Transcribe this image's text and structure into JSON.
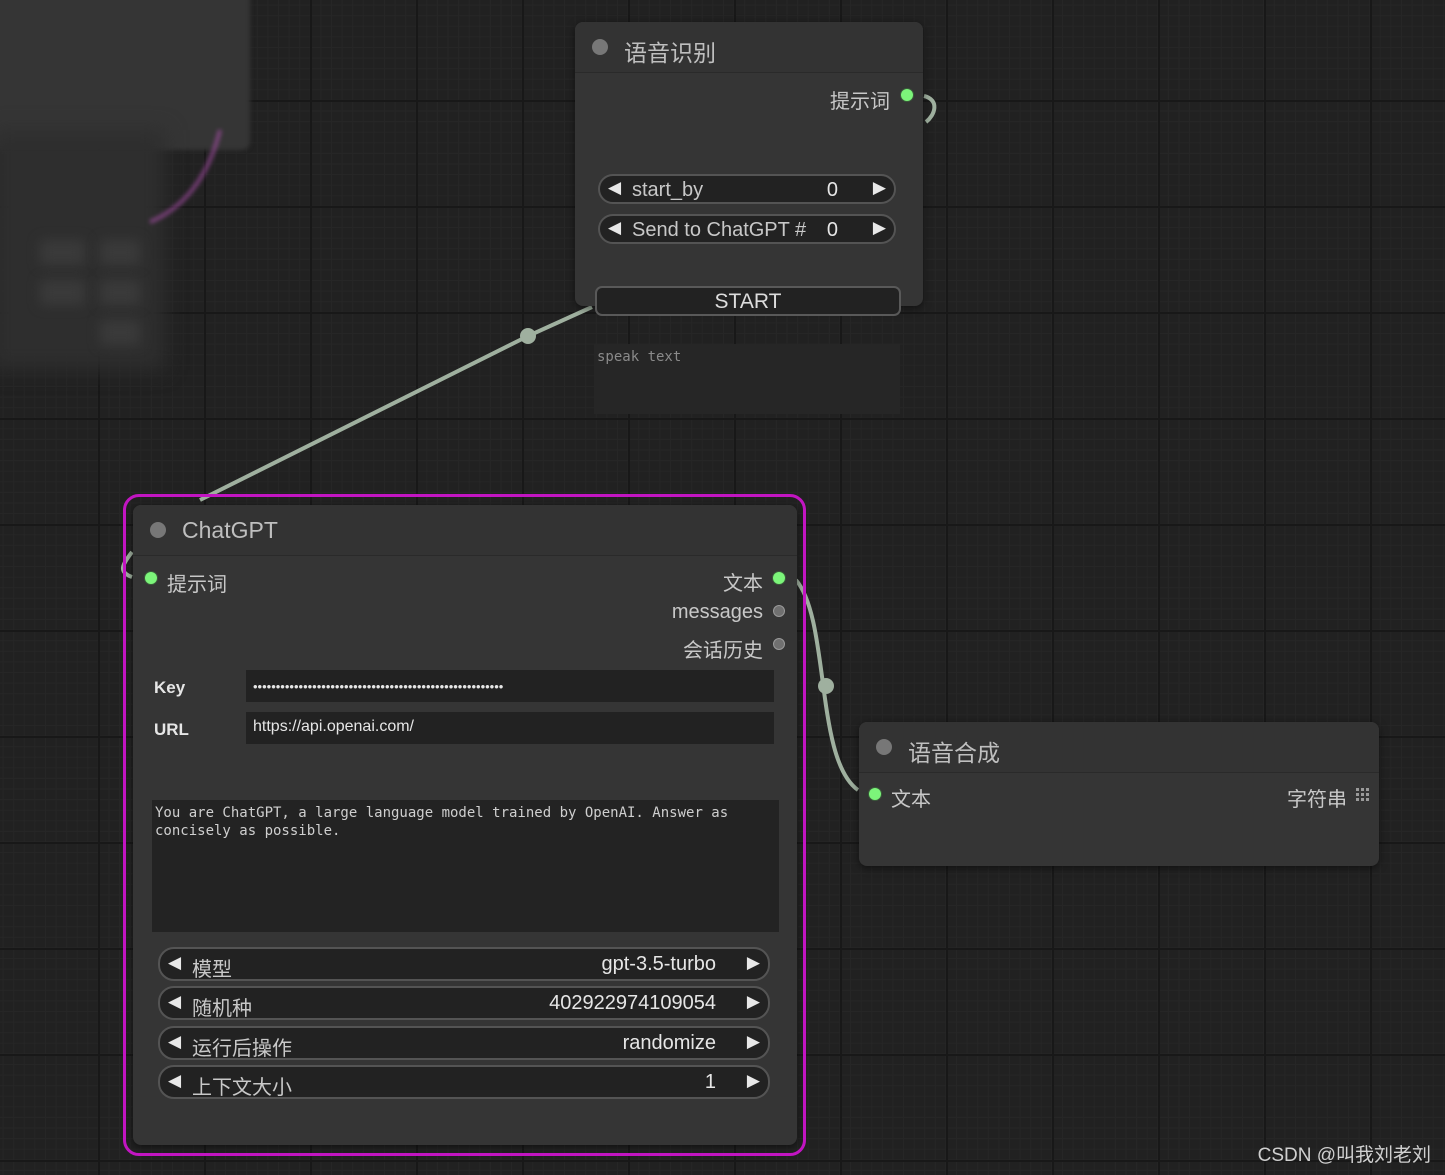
{
  "speech_recognition_node": {
    "title": "语音识别",
    "output_prompt": "提示词",
    "widgets": [
      {
        "label": "start_by",
        "value": "0"
      },
      {
        "label": "Send to ChatGPT #",
        "value": "0"
      }
    ],
    "start_button": "START",
    "speak_text_placeholder": "speak text"
  },
  "chatgpt_node": {
    "title": "ChatGPT",
    "input_prompt": "提示词",
    "outputs": [
      "文本",
      "messages",
      "会话历史"
    ],
    "key_label": "Key",
    "key_value": "•••••••••••••••••••••••••••••••••••••••••••••••••••••••",
    "url_label": "URL",
    "url_value": "https://api.openai.com/",
    "system_prompt": "You are ChatGPT, a large language model trained by OpenAI. Answer as concisely as possible.",
    "widgets": [
      {
        "label": "模型",
        "value": "gpt-3.5-turbo"
      },
      {
        "label": "随机种",
        "value": "402922974109054"
      },
      {
        "label": "运行后操作",
        "value": "randomize"
      },
      {
        "label": "上下文大小",
        "value": "1"
      }
    ]
  },
  "tts_node": {
    "title": "语音合成",
    "input_text": "文本",
    "input_type": "字符串"
  },
  "colors": {
    "selected_outline": "#c215c2",
    "connected_slot": "#7cf57a",
    "link": "#9fb09f",
    "link_magenta": "#b050b0"
  },
  "watermark": "CSDN @叫我刘老刘"
}
